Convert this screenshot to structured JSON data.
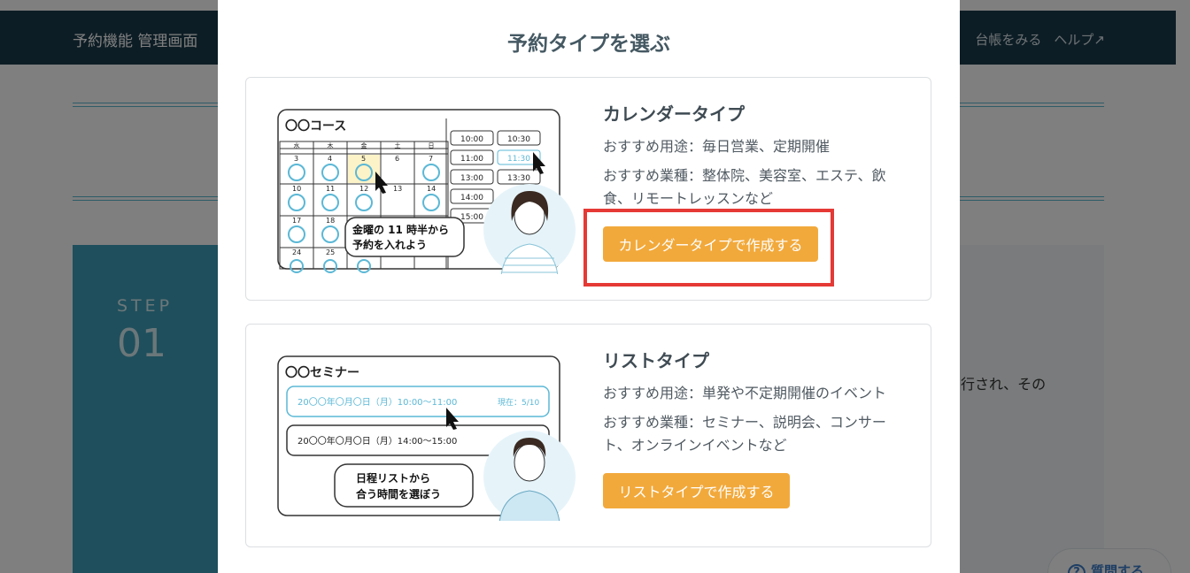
{
  "background": {
    "app_title": "予約機能 管理画面",
    "nav_items": [
      "台帳をみる",
      "ヘルプ↗"
    ],
    "step_label": "STEP",
    "step_number": "01",
    "partial_text": "行され、その",
    "help_button": "質問する"
  },
  "modal": {
    "title": "予約タイプを選ぶ",
    "calendar": {
      "title": "カレンダータイプ",
      "use": "おすすめ用途：毎日営業、定期開催",
      "industries": "おすすめ業種：整体院、美容室、エステ、飲食、リモートレッスンなど",
      "button": "カレンダータイプで作成する",
      "illustration": {
        "course": "〇〇コース",
        "weekdays": [
          "水",
          "木",
          "金",
          "土",
          "日"
        ],
        "dates_row1": [
          "3",
          "4",
          "5",
          "6",
          "7"
        ],
        "dates_row2": [
          "10",
          "11",
          "12",
          "13",
          "14"
        ],
        "dates_row3": [
          "17",
          "18"
        ],
        "dates_row4": [
          "24",
          "25"
        ],
        "times": [
          "10:00",
          "10:30",
          "11:00",
          "11:30",
          "13:00",
          "13:30",
          "14:00",
          "15:00"
        ],
        "bubble_line1": "金曜の 11 時半から",
        "bubble_line2": "予約を入れよう"
      }
    },
    "list": {
      "title": "リストタイプ",
      "use": "おすすめ用途：単発や不定期開催のイベント",
      "industries": "おすすめ業種：セミナー、説明会、コンサート、オンラインイベントなど",
      "button": "リストタイプで作成する",
      "illustration": {
        "seminar": "〇〇セミナー",
        "row1": "20〇〇年〇月〇日（月）10:00〜11:00",
        "row1_status": "現在：5/10",
        "row2": "20〇〇年〇月〇日（月）14:00〜15:00",
        "bubble_line1": "日程リストから",
        "bubble_line2": "合う時間を選ぼう"
      }
    }
  },
  "colors": {
    "accent_orange": "#f2a93b",
    "highlight_red": "#e53935",
    "topbar": "#1a3b4a",
    "step_blue": "#3f9fb8",
    "illus_blue": "#5bb8d6"
  }
}
